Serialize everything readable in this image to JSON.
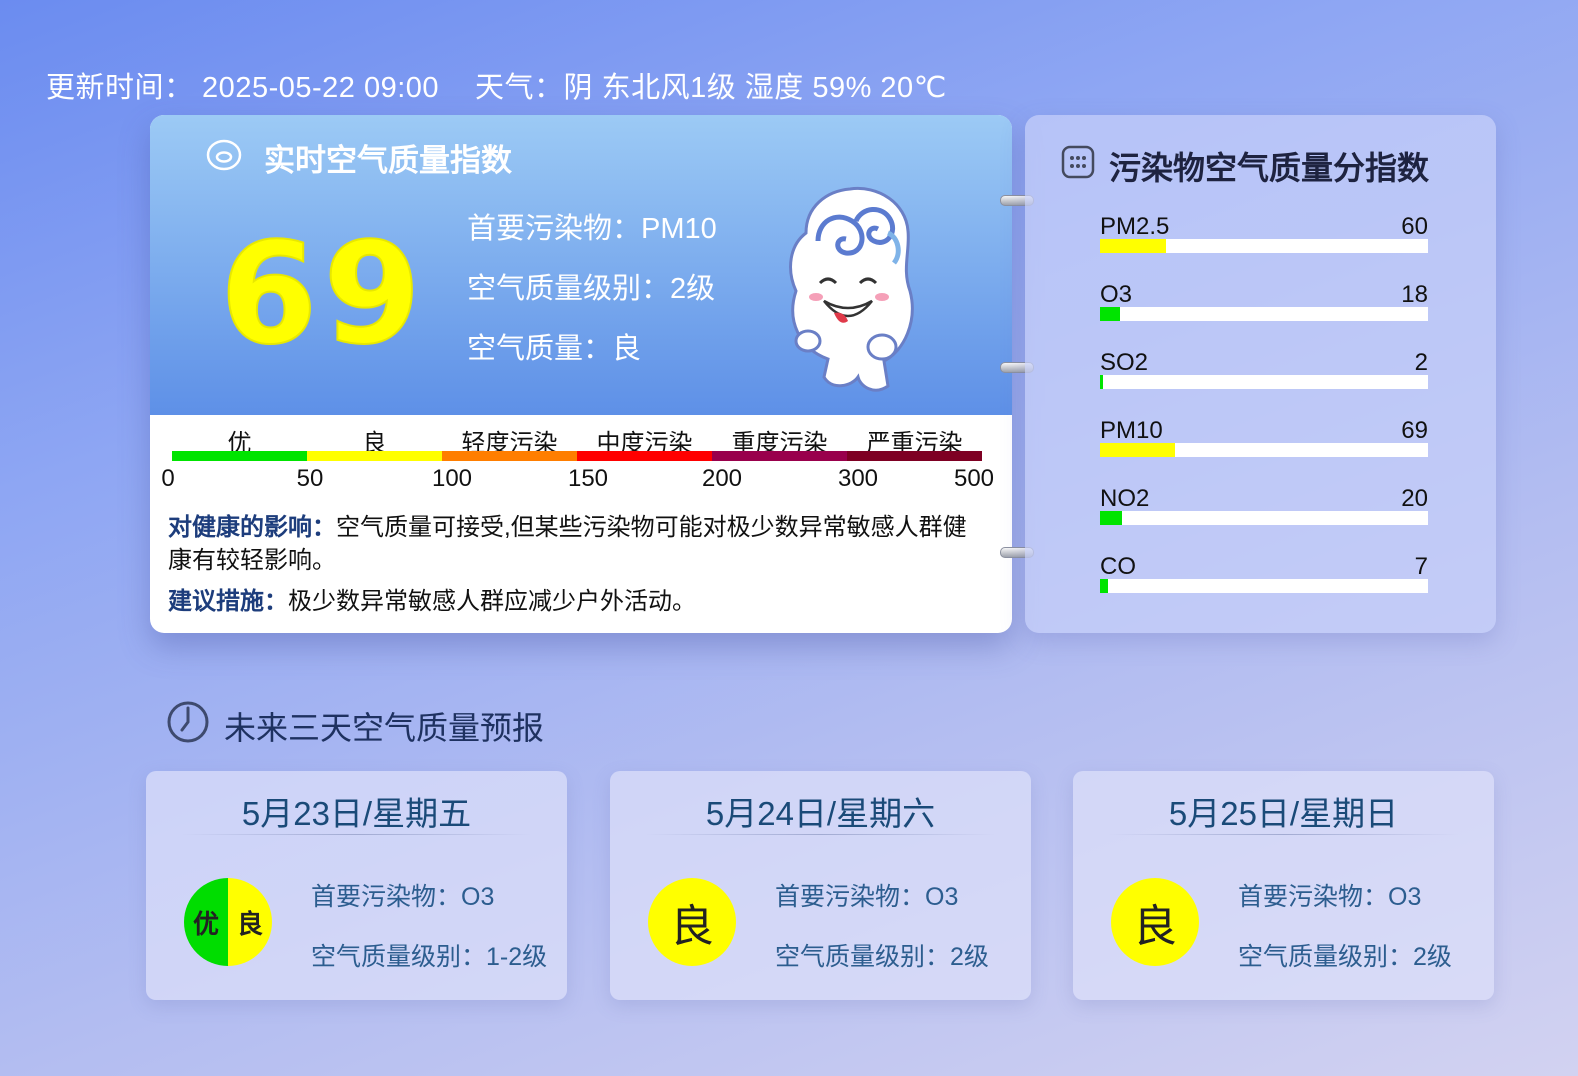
{
  "header": {
    "update_time": "更新时间：  2025-05-22 09:00",
    "weather": "天气：阴 东北风1级 湿度 59% 20℃"
  },
  "realtime": {
    "title": "实时空气质量指数",
    "aqi": "69",
    "primary_pollutant": "首要污染物：PM10",
    "level": "空气质量级别：2级",
    "quality": "空气质量：良",
    "scale": {
      "labels": [
        "优",
        "良",
        "轻度污染",
        "中度污染",
        "重度污染",
        "严重污染"
      ],
      "colors": [
        "#00e400",
        "#ffff00",
        "#ff7e00",
        "#ff0000",
        "#99004c",
        "#7e0023"
      ],
      "ticks": [
        "0",
        "50",
        "100",
        "150",
        "200",
        "300",
        "500"
      ]
    },
    "health_label": "对健康的影响：",
    "health_text": "空气质量可接受,但某些污染物可能对极少数异常敏感人群健康有较轻影响。",
    "advice_label": "建议措施：",
    "advice_text": "极少数异常敏感人群应减少户外活动。"
  },
  "pollutants": {
    "title": "污染物空气质量分指数",
    "items": [
      {
        "name": "PM2.5",
        "value": "60",
        "level": 0.2,
        "color": "#ffff00"
      },
      {
        "name": "O3",
        "value": "18",
        "level": 0.06,
        "color": "#00e400"
      },
      {
        "name": "SO2",
        "value": "2",
        "level": 0.007,
        "color": "#00e400"
      },
      {
        "name": "PM10",
        "value": "69",
        "level": 0.23,
        "color": "#ffff00"
      },
      {
        "name": "NO2",
        "value": "20",
        "level": 0.067,
        "color": "#00e400"
      },
      {
        "name": "CO",
        "value": "7",
        "level": 0.023,
        "color": "#00e400"
      }
    ]
  },
  "forecast": {
    "title": "未来三天空气质量预报",
    "days": [
      {
        "date": "5月23日/星期五",
        "badge_left": "优",
        "badge_right": "良",
        "primary": "首要污染物：O3",
        "level": "空气质量级别：1-2级"
      },
      {
        "date": "5月24日/星期六",
        "badge": "良",
        "primary": "首要污染物：O3",
        "level": "空气质量级别：2级"
      },
      {
        "date": "5月25日/星期日",
        "badge": "良",
        "primary": "首要污染物：O3",
        "level": "空气质量级别：2级"
      }
    ]
  },
  "icons": [
    "aqi-icon",
    "grid-icon",
    "clock-icon",
    "mascot"
  ]
}
